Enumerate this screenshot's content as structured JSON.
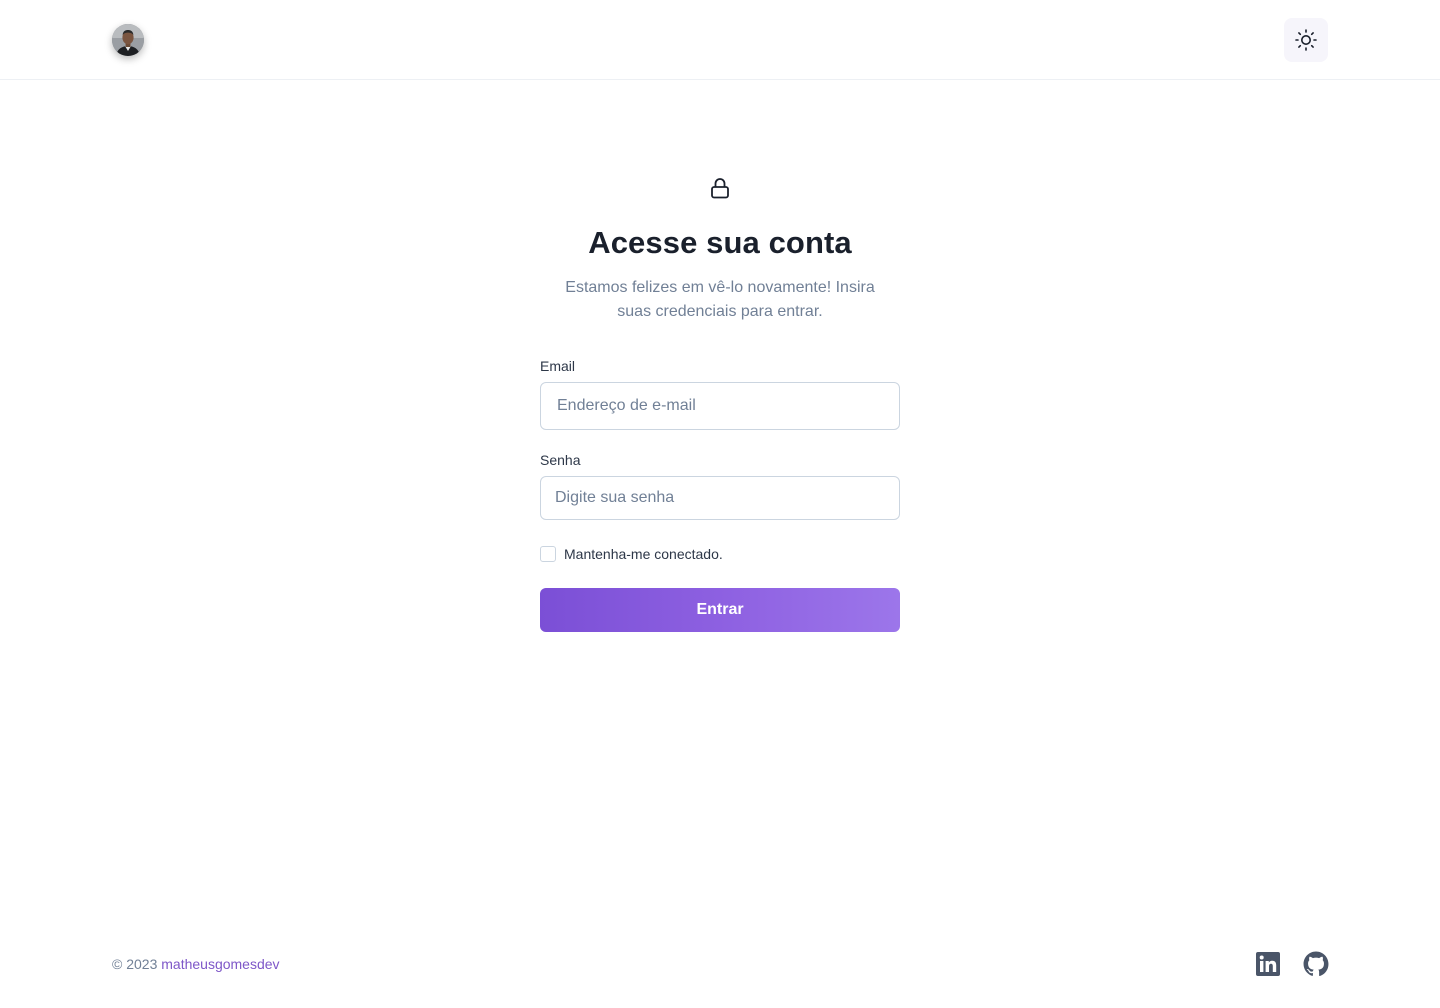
{
  "header": {
    "avatar_icon": "user-avatar-photo",
    "theme_toggle_icon": "sun-icon"
  },
  "login": {
    "icon": "lock-icon",
    "title": "Acesse sua conta",
    "subtitle": "Estamos felizes em vê-lo novamente! Insira suas credenciais para entrar.",
    "email_label": "Email",
    "email_placeholder": "Endereço de e-mail",
    "email_value": "",
    "password_label": "Senha",
    "password_placeholder": "Digite sua senha",
    "password_value": "",
    "remember_label": "Mantenha-me conectado.",
    "remember_checked": false,
    "submit_label": "Entrar"
  },
  "footer": {
    "copyright": "© 2023",
    "author": "matheusgomesdev",
    "social": [
      "linkedin-icon",
      "github-icon"
    ]
  },
  "colors": {
    "accent": "#805ad5",
    "heading": "#1a202c",
    "muted": "#718096",
    "border": "#cbd5e0"
  }
}
